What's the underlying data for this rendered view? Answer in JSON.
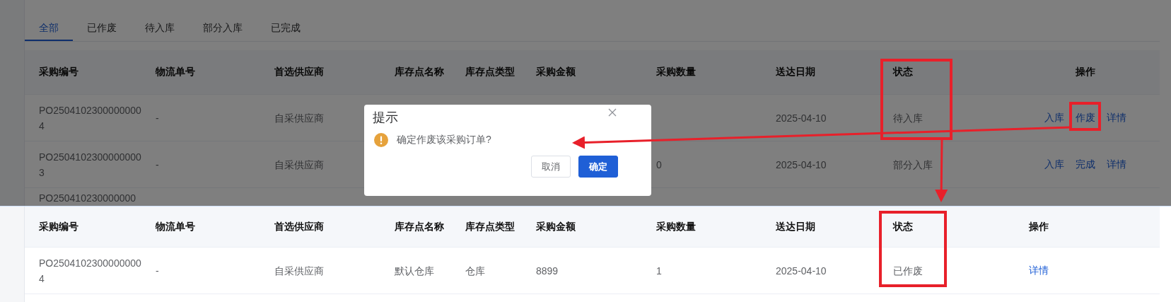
{
  "tabs": [
    {
      "label": "全部",
      "selected": true
    },
    {
      "label": "已作废",
      "selected": false
    },
    {
      "label": "待入库",
      "selected": false
    },
    {
      "label": "部分入库",
      "selected": false
    },
    {
      "label": "已完成",
      "selected": false
    }
  ],
  "table_before": {
    "columns": [
      "采购编号",
      "物流单号",
      "首选供应商",
      "库存点名称",
      "库存点类型",
      "采购金额",
      "采购数量",
      "送达日期",
      "状态",
      "操作"
    ],
    "rows": [
      {
        "order_no": "PO25041023000000004",
        "logistics_no": "-",
        "supplier": "自采供应商",
        "delivery_date": "2025-04-10",
        "status": "待入库",
        "actions": [
          "入库",
          "作废",
          "详情"
        ]
      },
      {
        "order_no": "PO25041023000000003",
        "logistics_no": "-",
        "supplier": "自采供应商",
        "quantity": "0",
        "delivery_date": "2025-04-10",
        "status": "部分入库",
        "actions": [
          "入库",
          "完成",
          "详情"
        ]
      },
      {
        "order_no": "PO250410230000000"
      }
    ]
  },
  "dialog": {
    "title": "提示",
    "message": "确定作废该采购订单?",
    "buttons": [
      {
        "label": "取消",
        "kind": "secondary"
      },
      {
        "label": "确定",
        "kind": "primary"
      }
    ]
  },
  "table_after": {
    "columns": [
      "采购编号",
      "物流单号",
      "首选供应商",
      "库存点名称",
      "库存点类型",
      "采购金额",
      "采购数量",
      "送达日期",
      "状态",
      "操作"
    ],
    "rows": [
      {
        "order_no": "PO25041023000000004",
        "logistics_no": "-",
        "supplier": "自采供应商",
        "site_name": "默认仓库",
        "site_type": "仓库",
        "amount": "8899",
        "quantity": "1",
        "delivery_date": "2025-04-10",
        "status": "已作废",
        "actions": [
          "详情"
        ]
      }
    ]
  }
}
